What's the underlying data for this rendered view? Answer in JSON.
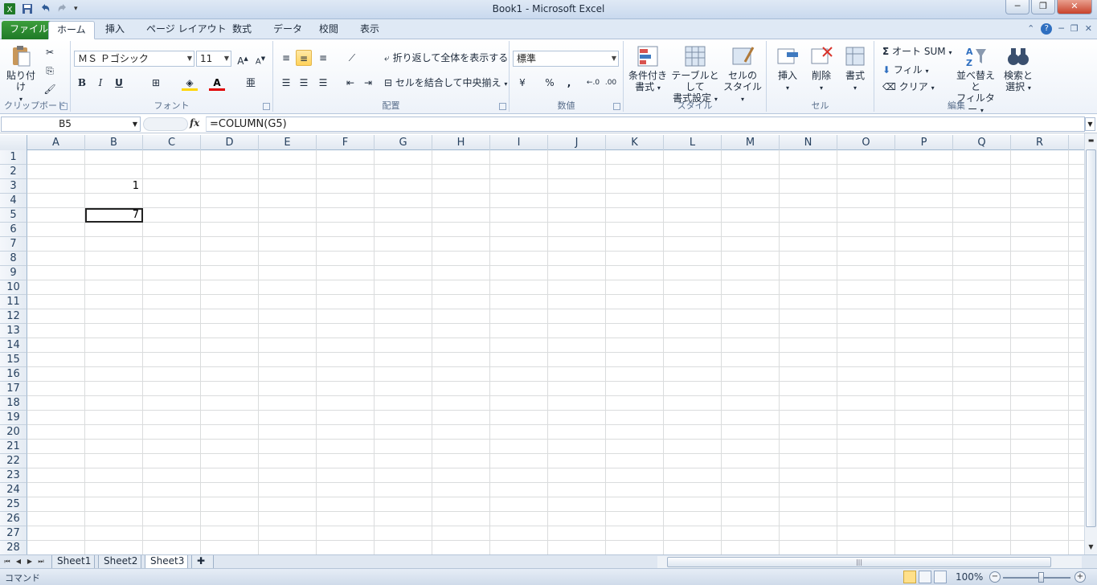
{
  "window": {
    "title": "Book1 - Microsoft Excel",
    "minimize": "─",
    "restore": "❐",
    "close": "✕"
  },
  "tabs": {
    "file": "ファイル",
    "home": "ホーム",
    "insert": "挿入",
    "page_layout": "ページ レイアウト",
    "formulas": "数式",
    "data": "データ",
    "review": "校閲",
    "view": "表示"
  },
  "ribbon": {
    "clipboard": {
      "paste": "貼り付け",
      "label": "クリップボード"
    },
    "font": {
      "name": "ＭＳ Ｐゴシック",
      "size": "11",
      "bold": "B",
      "italic": "I",
      "underline": "U",
      "label": "フォント"
    },
    "alignment": {
      "wrap": "折り返して全体を表示する",
      "merge": "セルを結合して中央揃え",
      "label": "配置"
    },
    "number": {
      "format": "標準",
      "percent": "%",
      "comma": ",",
      "label": "数値"
    },
    "styles": {
      "conditional": [
        "条件付き",
        "書式"
      ],
      "table": [
        "テーブルとして",
        "書式設定"
      ],
      "cell": [
        "セルの",
        "スタイル"
      ],
      "label": "スタイル"
    },
    "cells": {
      "insert": "挿入",
      "delete": "削除",
      "format": "書式",
      "label": "セル"
    },
    "editing": {
      "autosum": "オート SUM",
      "fill": "フィル",
      "clear": "クリア",
      "sort": [
        "並べ替えと",
        "フィルター"
      ],
      "find": [
        "検索と",
        "選択"
      ],
      "label": "編集"
    }
  },
  "formula_bar": {
    "name_box": "B5",
    "fx": "fx",
    "formula": "=COLUMN(G5)"
  },
  "grid": {
    "columns": [
      "A",
      "B",
      "C",
      "D",
      "E",
      "F",
      "G",
      "H",
      "I",
      "J",
      "K",
      "L",
      "M",
      "N",
      "O",
      "P",
      "Q",
      "R"
    ],
    "rows": [
      "1",
      "2",
      "3",
      "4",
      "5",
      "6",
      "7",
      "8",
      "9",
      "10",
      "11",
      "12",
      "13",
      "14",
      "15",
      "16",
      "17",
      "18",
      "19",
      "20",
      "21",
      "22",
      "23",
      "24",
      "25",
      "26",
      "27",
      "28"
    ],
    "cells": [
      {
        "ref": "B3",
        "value": "1"
      },
      {
        "ref": "B5",
        "value": "7"
      }
    ],
    "selected": "B5"
  },
  "sheets": [
    "Sheet1",
    "Sheet2",
    "Sheet3"
  ],
  "active_sheet": "Sheet3",
  "status": {
    "mode": "コマンド",
    "zoom": "100%"
  }
}
